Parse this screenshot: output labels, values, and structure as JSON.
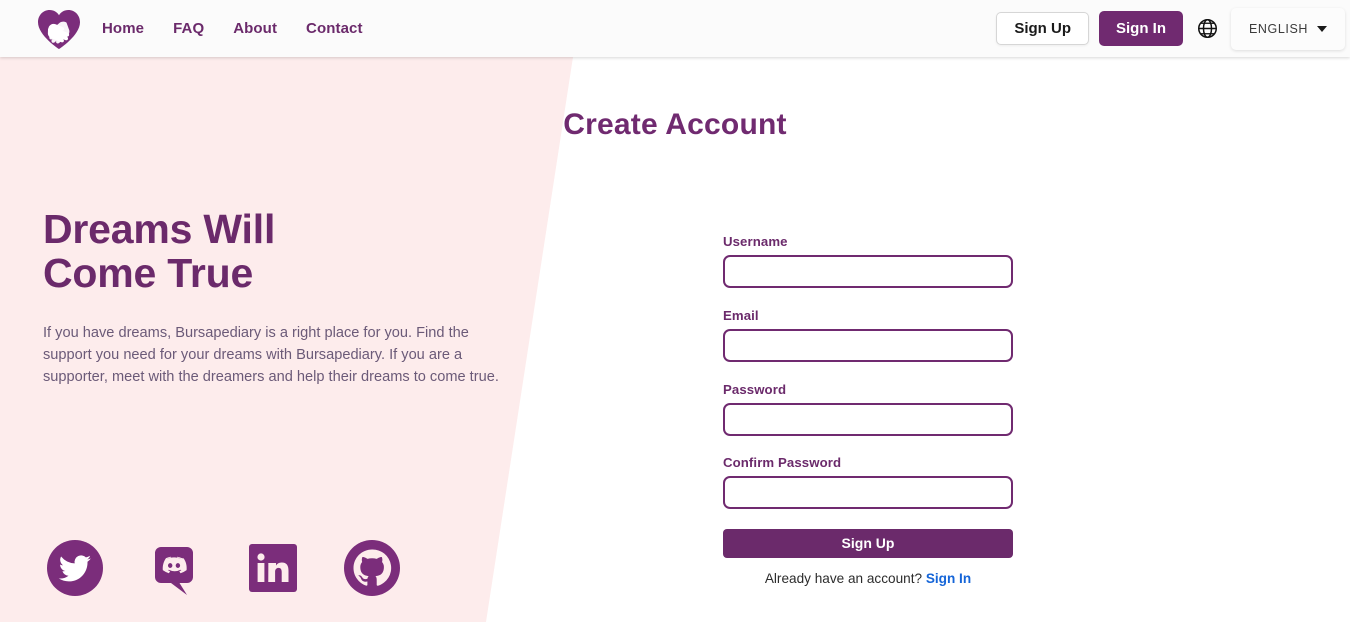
{
  "header": {
    "logo_alt": "bursapediary-heart-hands-logo",
    "nav": [
      {
        "label": "Home"
      },
      {
        "label": "FAQ"
      },
      {
        "label": "About"
      },
      {
        "label": "Contact"
      }
    ],
    "sign_up_label": "Sign Up",
    "sign_in_label": "Sign In",
    "globe_icon": "globe-icon",
    "language": {
      "selected": "ENGLISH",
      "options": [
        "ENGLISH"
      ]
    }
  },
  "hero": {
    "title_line1": "Dreams Will",
    "title_line2": "Come True",
    "description": "If you have dreams, Bursapediary is a right place for you. Find the support you need for your dreams with Bursapediary. If you are a supporter, meet with the dreamers and help their dreams to come true.",
    "socials": [
      {
        "name": "twitter-icon",
        "label": "Twitter"
      },
      {
        "name": "discord-icon",
        "label": "Discord"
      },
      {
        "name": "linkedin-icon",
        "label": "LinkedIn"
      },
      {
        "name": "github-icon",
        "label": "GitHub"
      }
    ]
  },
  "form": {
    "title": "Create Account",
    "fields": [
      {
        "label": "Username",
        "value": "",
        "placeholder": "",
        "type": "text"
      },
      {
        "label": "Email",
        "value": "",
        "placeholder": "",
        "type": "text"
      },
      {
        "label": "Password",
        "value": "",
        "placeholder": "",
        "type": "password"
      },
      {
        "label": "Confirm Password",
        "value": "",
        "placeholder": "",
        "type": "password"
      }
    ],
    "submit_label": "Sign Up",
    "footer_text": "Already have an account?",
    "footer_link": "Sign In"
  },
  "colors": {
    "brand_purple": "#702a70",
    "hero_pink": "#fdecec",
    "link_blue": "#1565d8",
    "header_bg": "#fbfbfb"
  }
}
